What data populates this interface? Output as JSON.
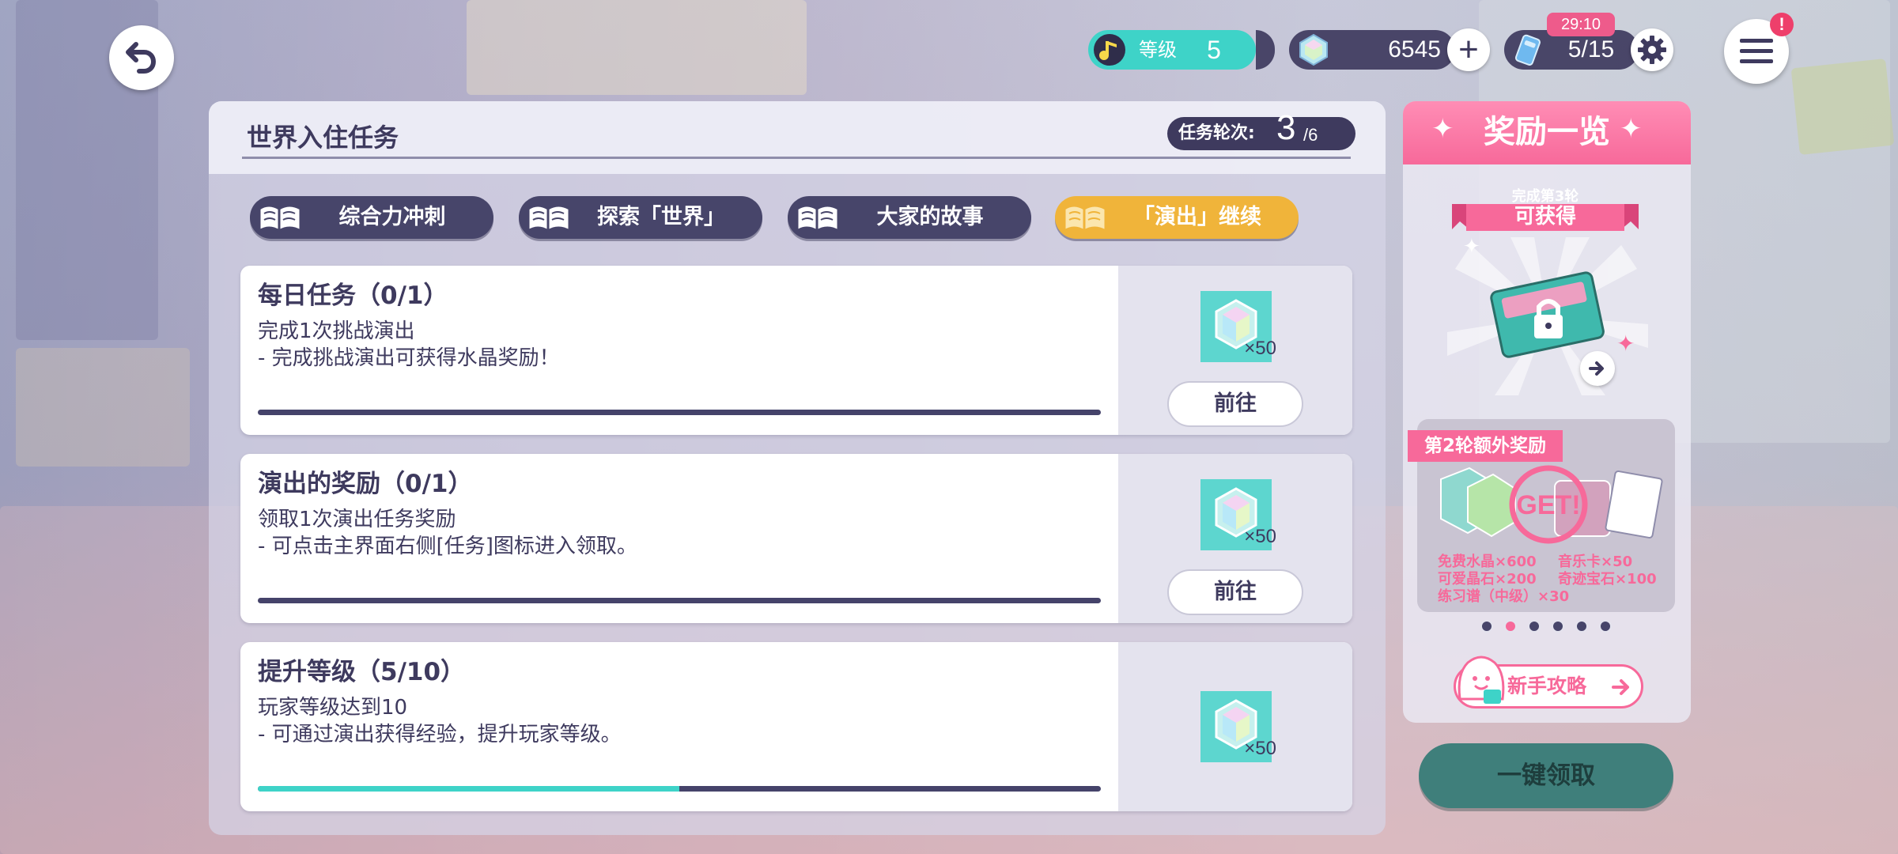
{
  "header": {
    "back_icon": "back-arrow-icon",
    "menu_icon": "hamburger-menu-icon",
    "menu_alert": "!"
  },
  "resources": {
    "level_label": "等级",
    "level_value": "5",
    "crystal_value": "6545",
    "plus_label": "+",
    "stamina_value": "5/15",
    "stamina_timer": "29:10"
  },
  "panel": {
    "title": "世界入住任务",
    "round_label": "任务轮次:",
    "round_current": "3",
    "round_total": "/6"
  },
  "tabs": [
    {
      "label": "综合力冲刺",
      "active": false
    },
    {
      "label": "探索「世界」",
      "active": false
    },
    {
      "label": "大家的故事",
      "active": false
    },
    {
      "label": "「演出」继续",
      "active": true
    }
  ],
  "tasks": [
    {
      "title": "每日任务（0/1）",
      "line1": "完成1次挑战演出",
      "line2": "- 完成挑战演出可获得水晶奖励！",
      "progress": 0.0,
      "reward_qty": "×50",
      "button": "前往"
    },
    {
      "title": "演出的奖励（0/1）",
      "line1": "领取1次演出任务奖励",
      "line2": "- 可点击主界面右侧[任务]图标进入领取。",
      "progress": 0.0,
      "reward_qty": "×50",
      "button": "前往"
    },
    {
      "title": "提升等级（5/10）",
      "line1": "玩家等级达到10",
      "line2": "- 可通过演出获得经验，提升玩家等级。",
      "progress": 0.5,
      "reward_qty": "×50",
      "button": null
    }
  ],
  "rewards_panel": {
    "title": "奖励一览",
    "ribbon_top": "完成第3轮",
    "ribbon_main": "可获得",
    "bonus_tag": "第2轮额外奖励",
    "bonus_items": [
      "免费水晶×600",
      "音乐卡×50",
      "可爱晶石×200",
      "奇迹宝石×100",
      "练习谱（中级）×30"
    ],
    "carousel_total": 6,
    "carousel_active": 1,
    "guide_label": "新手攻略"
  },
  "claim_all": "一键领取",
  "colors": {
    "navy": "#3e3a5e",
    "teal": "#3ed3c8",
    "pink": "#f7699a",
    "gold": "#f0b43a"
  }
}
